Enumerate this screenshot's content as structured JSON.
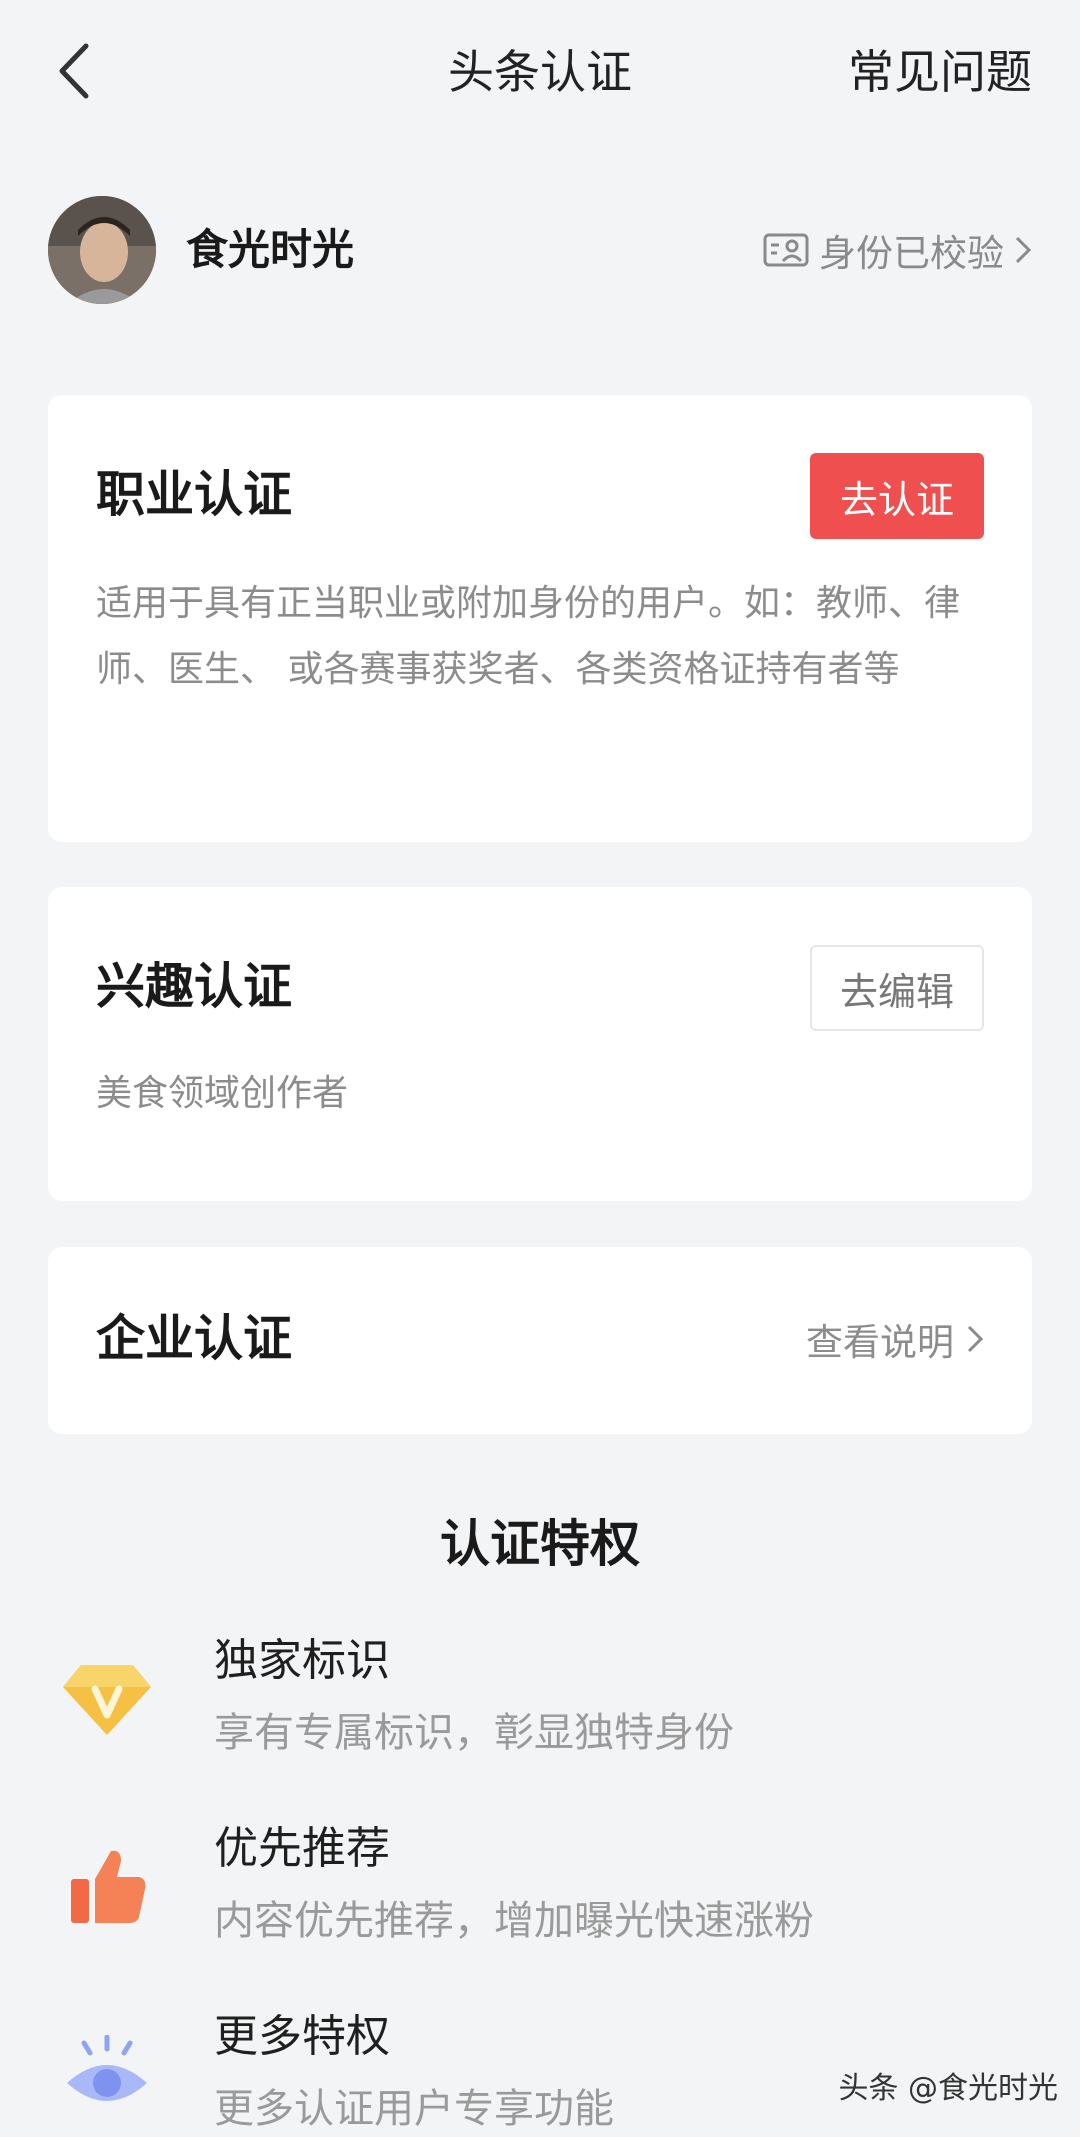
{
  "nav": {
    "title": "头条认证",
    "faq_label": "常见问题",
    "back_icon": "chevron-left-icon"
  },
  "profile": {
    "username": "食光时光",
    "verified_label": "身份已校验",
    "verified_icon": "id-card-icon"
  },
  "cards": {
    "professional": {
      "title": "职业认证",
      "button_label": "去认证",
      "description": "适用于具有正当职业或附加身份的用户。如：教师、律师、医生、 或各赛事获奖者、各类资格证持有者等"
    },
    "interest": {
      "title": "兴趣认证",
      "button_label": "去编辑",
      "description": "美食领域创作者"
    },
    "enterprise": {
      "title": "企业认证",
      "link_label": "查看说明"
    }
  },
  "privileges": {
    "title": "认证特权",
    "items": [
      {
        "icon": "diamond-v-icon",
        "title": "独家标识",
        "subtitle": "享有专属标识，彰显独特身份"
      },
      {
        "icon": "thumbs-up-icon",
        "title": "优先推荐",
        "subtitle": "内容优先推荐，增加曝光快速涨粉"
      },
      {
        "icon": "eye-icon",
        "title": "更多特权",
        "subtitle": "更多认证用户专享功能"
      }
    ]
  },
  "watermark": "头条 @食光时光",
  "colors": {
    "accent": "#f04f4f",
    "background": "#f3f4f6",
    "card": "#ffffff",
    "diamond": "#f5c043",
    "thumb": "#f26a45",
    "eye": "#8fa3f5"
  }
}
